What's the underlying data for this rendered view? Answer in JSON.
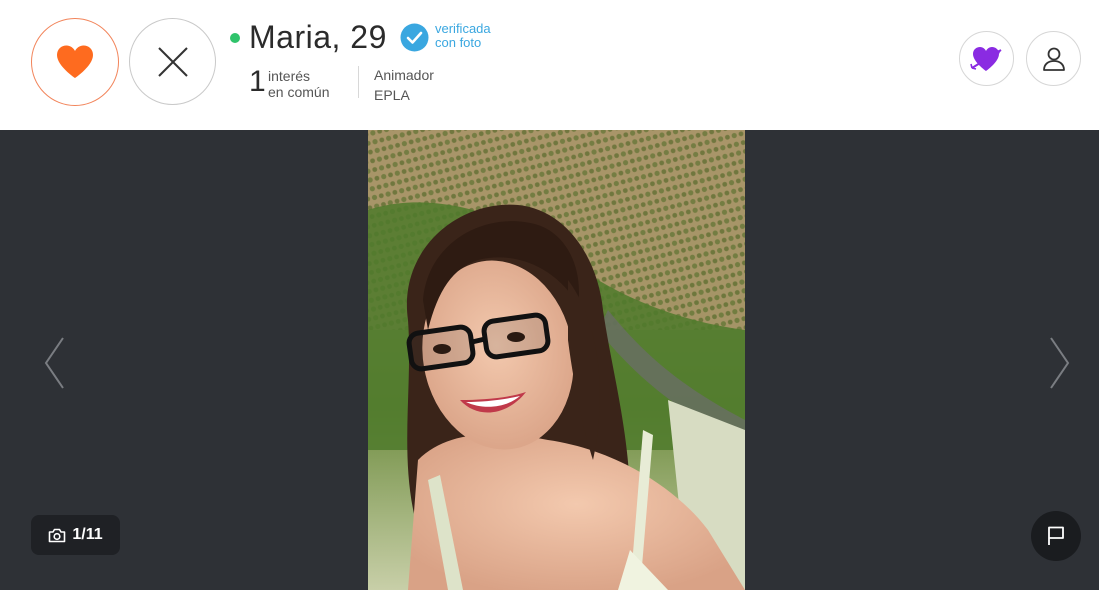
{
  "profile": {
    "name_age": "Maria, 29",
    "verified_line1": "verificada",
    "verified_line2": "con foto",
    "interest_count": "1",
    "interest_line1": "interés",
    "interest_line2": "en común",
    "job_line1": "Animador",
    "job_line2": "EPLA"
  },
  "actions": {
    "like_icon": "heart-icon",
    "pass_icon": "close-icon",
    "crush_icon": "heart-arrow-icon",
    "profile_icon": "user-icon",
    "report_icon": "flag-icon"
  },
  "gallery": {
    "counter": "1/11",
    "camera_icon": "camera-icon"
  },
  "colors": {
    "like": "#fe6b1f",
    "online": "#2fc36b",
    "verified": "#3aa7e0",
    "crush": "#8a2be2",
    "viewer_bg": "#2e3136"
  }
}
